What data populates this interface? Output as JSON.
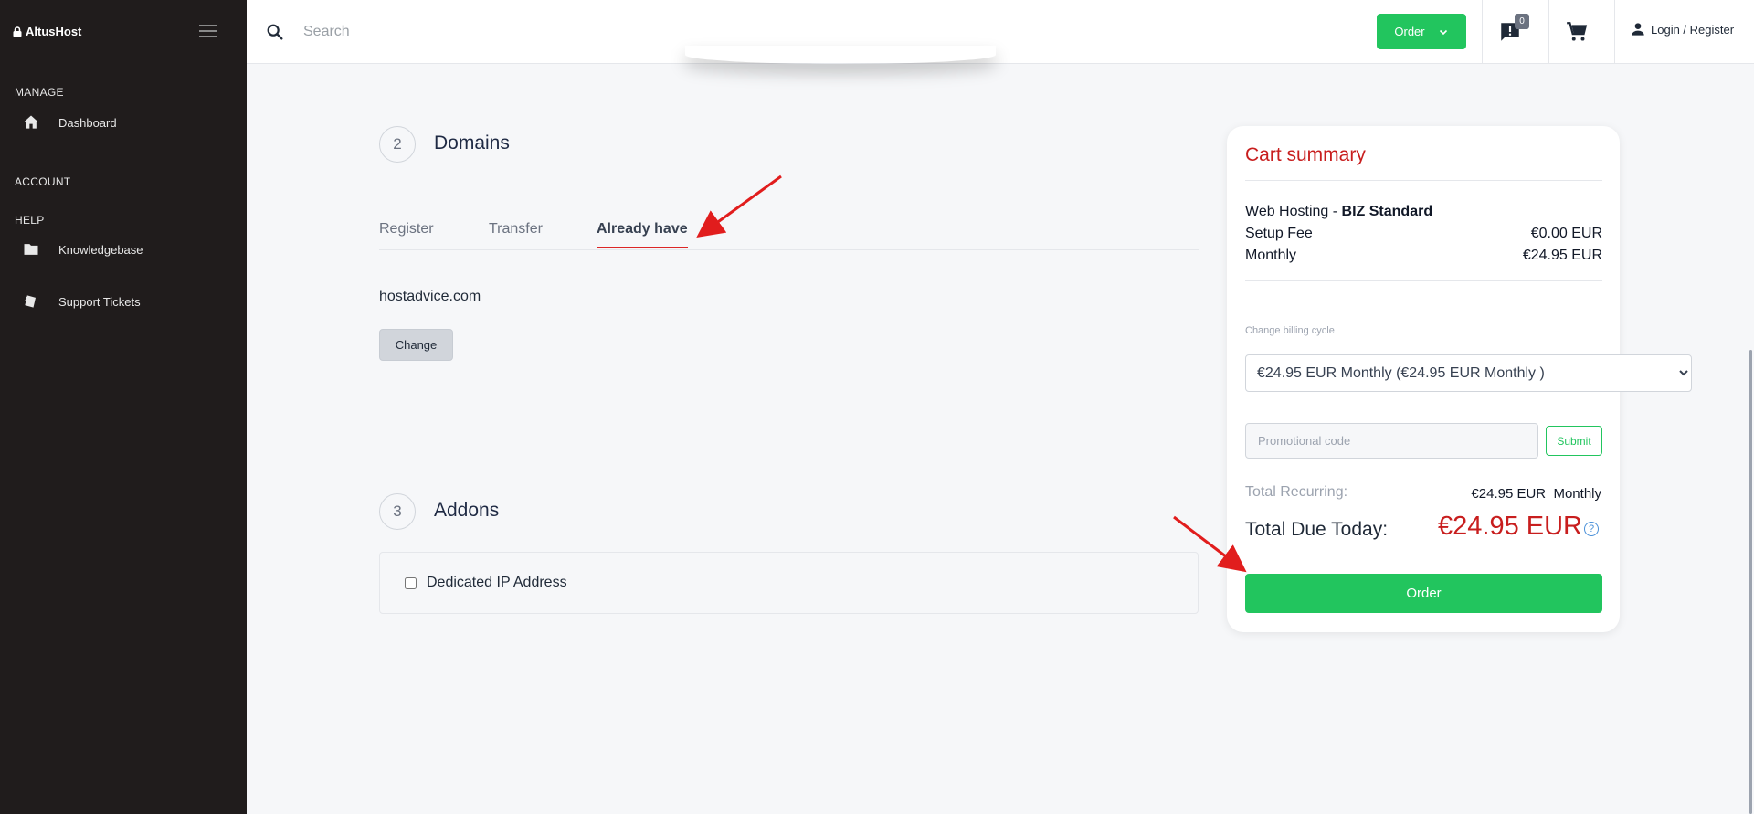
{
  "brand": {
    "name": "AltusHost"
  },
  "sidebar": {
    "sections": [
      "MANAGE",
      "ACCOUNT",
      "HELP"
    ],
    "items": [
      {
        "label": "Dashboard",
        "icon": "home-icon"
      },
      {
        "label": "Knowledgebase",
        "icon": "folder-icon"
      },
      {
        "label": "Support Tickets",
        "icon": "tickets-icon"
      }
    ]
  },
  "topbar": {
    "search_placeholder": "Search",
    "order_label": "Order",
    "notifications_count": "0",
    "login_label": "Login / Register"
  },
  "main": {
    "domains": {
      "step": "2",
      "title": "Domains",
      "tabs": [
        "Register",
        "Transfer",
        "Already have"
      ],
      "active_tab": "Already have",
      "domain": "hostadvice.com",
      "change_label": "Change"
    },
    "addons": {
      "step": "3",
      "title": "Addons",
      "items": [
        {
          "label": "Dedicated IP Address",
          "checked": false
        }
      ]
    }
  },
  "cart": {
    "title": "Cart summary",
    "product_prefix": "Web Hosting - ",
    "product_name": "BIZ Standard",
    "setup_fee_label": "Setup Fee",
    "setup_fee_value": "€0.00 EUR",
    "monthly_label": "Monthly",
    "monthly_value": "€24.95 EUR",
    "billing_cycle_label": "Change billing cycle",
    "billing_cycle_value": "€24.95 EUR Monthly (€24.95 EUR Monthly )",
    "promo_placeholder": "Promotional code",
    "submit_label": "Submit",
    "total_recurring_label": "Total Recurring:",
    "total_recurring_value": "€24.95 EUR  Monthly",
    "total_due_label": "Total Due Today:",
    "total_due_value": "€24.95 EUR",
    "help_glyph": "?",
    "order_label": "Order"
  },
  "colors": {
    "accent_green": "#22c55e",
    "accent_red": "#c81e1e",
    "sidebar_bg": "#201c1c"
  }
}
